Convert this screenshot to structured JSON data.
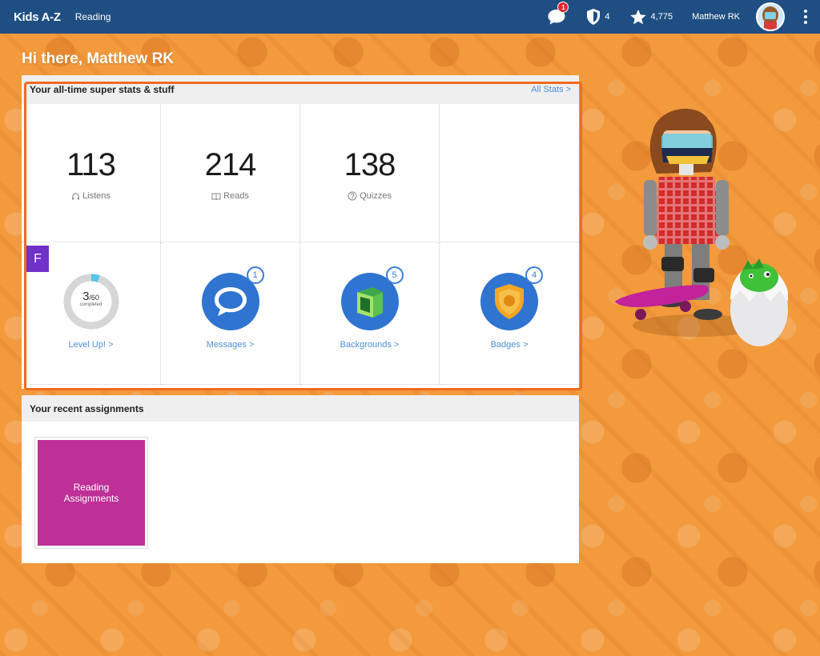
{
  "topbar": {
    "brand": "Kids A-Z",
    "section": "Reading",
    "messages_badge": "1",
    "shields": "4",
    "stars": "4,775",
    "username": "Matthew RK"
  },
  "greeting": "Hi there, Matthew RK",
  "stats": {
    "title": "Your all-time super stats & stuff",
    "all_stats_link": "All Stats >",
    "listens": {
      "value": "113",
      "label": "Listens"
    },
    "reads": {
      "value": "214",
      "label": "Reads"
    },
    "quizzes": {
      "value": "138",
      "label": "Quizzes"
    },
    "level_up": {
      "progress": "3",
      "total": "/60",
      "caption": "completed",
      "link": "Level Up! >",
      "fraction": 0.05
    },
    "messages": {
      "count": "1",
      "link": "Messages >"
    },
    "backgrounds": {
      "count": "5",
      "link": "Backgrounds >"
    },
    "badges": {
      "count": "4",
      "link": "Badges >"
    }
  },
  "f_chip": "F",
  "assignments": {
    "title": "Your recent assignments",
    "tile_line1": "Reading",
    "tile_line2": "Assignments"
  },
  "colors": {
    "topbar": "#1f4f82",
    "background": "#f29a3c",
    "highlight": "#f06b22",
    "link": "#4f8fd8",
    "tile": "#be2f97",
    "chip": "#7031c9"
  }
}
